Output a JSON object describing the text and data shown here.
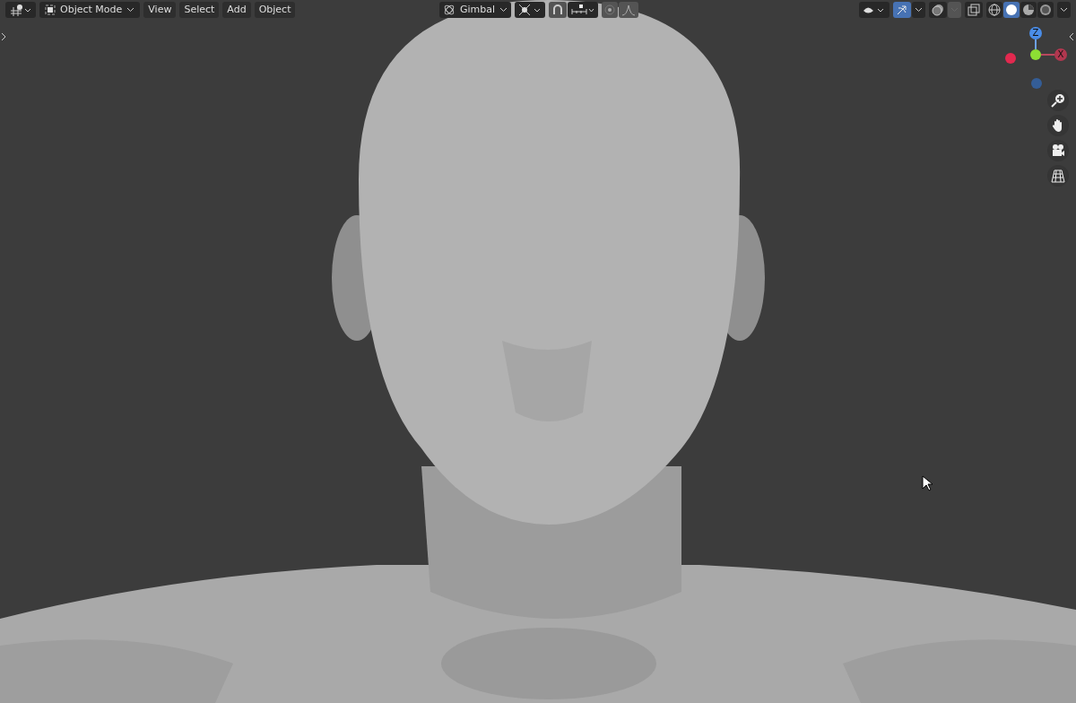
{
  "header": {
    "mode": "Object Mode",
    "menus": [
      "View",
      "Select",
      "Add",
      "Object"
    ],
    "orientation": "Gimbal",
    "snap": {
      "on": false
    },
    "proportional": {
      "on": false
    },
    "overlays": {
      "on": true
    },
    "xray": {
      "on": false
    },
    "shading": [
      {
        "kind": "wireframe",
        "selected": false
      },
      {
        "kind": "solid",
        "selected": true
      },
      {
        "kind": "material",
        "selected": false
      },
      {
        "kind": "rendered",
        "selected": false
      }
    ]
  },
  "gizmo": {
    "z_label": "Z",
    "x_label": "X"
  }
}
